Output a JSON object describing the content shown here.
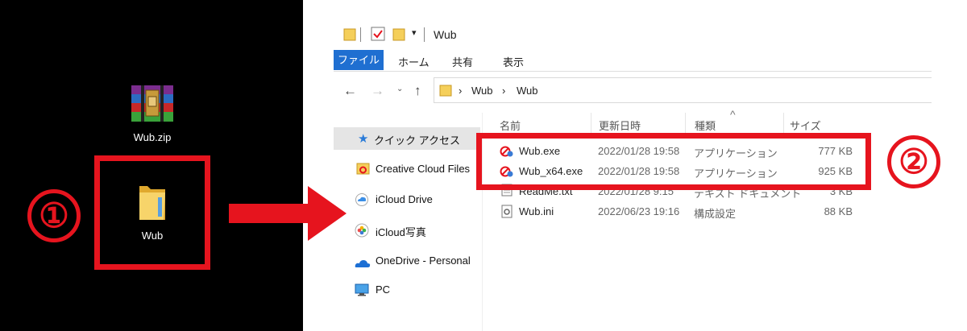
{
  "colors": {
    "accent_red": "#e6141e",
    "ribbon_blue": "#1f6fd1",
    "folder_yellow": "#f3c94c"
  },
  "desktop": {
    "zip_label": "Wub.zip",
    "folder_label": "Wub",
    "step1": "①",
    "step2": "②"
  },
  "window": {
    "title": "Wub",
    "ribbon_tabs": [
      "ファイル",
      "ホーム",
      "共有",
      "表示"
    ],
    "breadcrumb": [
      "Wub",
      "Wub"
    ],
    "columns": {
      "name": "名前",
      "date": "更新日時",
      "type": "種類",
      "size": "サイズ"
    },
    "sidebar": [
      {
        "label": "クイック アクセス",
        "icon": "star-icon"
      },
      {
        "label": "Creative Cloud Files",
        "icon": "creative-cloud-icon"
      },
      {
        "label": "iCloud Drive",
        "icon": "cloud-icon"
      },
      {
        "label": "iCloud写真",
        "icon": "photos-icon"
      },
      {
        "label": "OneDrive - Personal",
        "icon": "onedrive-icon"
      },
      {
        "label": "PC",
        "icon": "pc-icon"
      }
    ],
    "files": [
      {
        "name": "Wub.exe",
        "date": "2022/01/28 19:58",
        "type": "アプリケーション",
        "size": "777 KB"
      },
      {
        "name": "Wub_x64.exe",
        "date": "2022/01/28 19:58",
        "type": "アプリケーション",
        "size": "925 KB"
      },
      {
        "name": "ReadMe.txt",
        "date": "2022/01/28 9:15",
        "type": "テキスト ドキュメント",
        "size": "3 KB"
      },
      {
        "name": "Wub.ini",
        "date": "2022/06/23 19:16",
        "type": "構成設定",
        "size": "88 KB"
      }
    ]
  }
}
